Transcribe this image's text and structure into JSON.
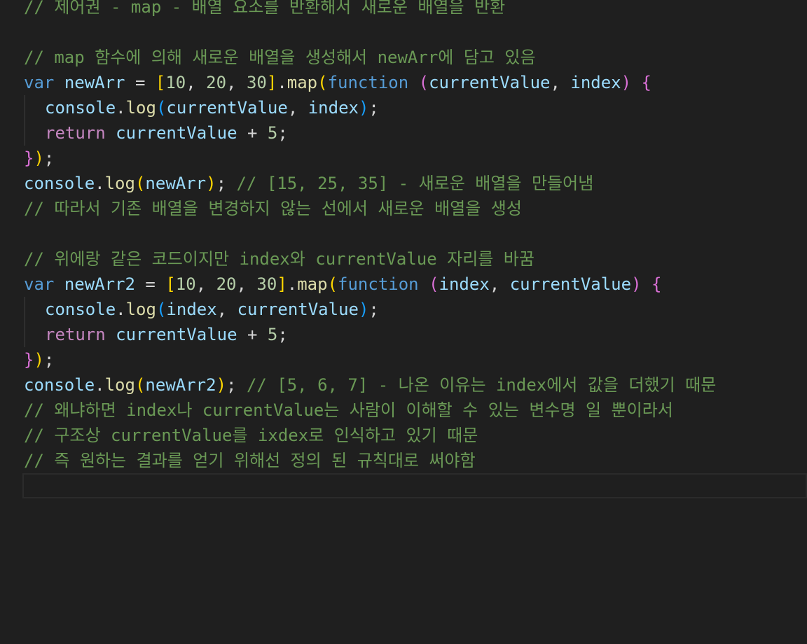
{
  "editor": {
    "lines": [
      {
        "segments": [
          {
            "t": "// 제어권 - map - 배열 요소를 반환해서 새로운 배열을 반환",
            "c": "comment"
          }
        ]
      },
      {
        "segments": []
      },
      {
        "segments": [
          {
            "t": "// map 함수에 의해 새로운 배열을 생성해서 newArr에 담고 있음",
            "c": "comment"
          }
        ]
      },
      {
        "segments": [
          {
            "t": "var",
            "c": "kw"
          },
          {
            "t": " ",
            "c": "op"
          },
          {
            "t": "newArr",
            "c": "var"
          },
          {
            "t": " = ",
            "c": "op"
          },
          {
            "t": "[",
            "c": "b1"
          },
          {
            "t": "10",
            "c": "num"
          },
          {
            "t": ", ",
            "c": "op"
          },
          {
            "t": "20",
            "c": "num"
          },
          {
            "t": ", ",
            "c": "op"
          },
          {
            "t": "30",
            "c": "num"
          },
          {
            "t": "]",
            "c": "b1"
          },
          {
            "t": ".",
            "c": "op"
          },
          {
            "t": "map",
            "c": "fn"
          },
          {
            "t": "(",
            "c": "b1"
          },
          {
            "t": "function",
            "c": "kw"
          },
          {
            "t": " ",
            "c": "op"
          },
          {
            "t": "(",
            "c": "b2"
          },
          {
            "t": "currentValue",
            "c": "var"
          },
          {
            "t": ", ",
            "c": "op"
          },
          {
            "t": "index",
            "c": "var"
          },
          {
            "t": ")",
            "c": "b2"
          },
          {
            "t": " ",
            "c": "op"
          },
          {
            "t": "{",
            "c": "b2"
          }
        ]
      },
      {
        "indent": true,
        "segments": [
          {
            "t": "console",
            "c": "var"
          },
          {
            "t": ".",
            "c": "op"
          },
          {
            "t": "log",
            "c": "fn"
          },
          {
            "t": "(",
            "c": "b3"
          },
          {
            "t": "currentValue",
            "c": "var"
          },
          {
            "t": ", ",
            "c": "op"
          },
          {
            "t": "index",
            "c": "var"
          },
          {
            "t": ")",
            "c": "b3"
          },
          {
            "t": ";",
            "c": "op"
          }
        ]
      },
      {
        "indent": true,
        "segments": [
          {
            "t": "return",
            "c": "ctrl"
          },
          {
            "t": " ",
            "c": "op"
          },
          {
            "t": "currentValue",
            "c": "var"
          },
          {
            "t": " + ",
            "c": "op"
          },
          {
            "t": "5",
            "c": "num"
          },
          {
            "t": ";",
            "c": "op"
          }
        ]
      },
      {
        "segments": [
          {
            "t": "}",
            "c": "b2"
          },
          {
            "t": ")",
            "c": "b1"
          },
          {
            "t": ";",
            "c": "op"
          }
        ]
      },
      {
        "segments": [
          {
            "t": "console",
            "c": "var"
          },
          {
            "t": ".",
            "c": "op"
          },
          {
            "t": "log",
            "c": "fn"
          },
          {
            "t": "(",
            "c": "b1"
          },
          {
            "t": "newArr",
            "c": "var"
          },
          {
            "t": ")",
            "c": "b1"
          },
          {
            "t": "; ",
            "c": "op"
          },
          {
            "t": "// [15, 25, 35] - 새로운 배열을 만들어냄",
            "c": "comment"
          }
        ]
      },
      {
        "segments": [
          {
            "t": "// 따라서 기존 배열을 변경하지 않는 선에서 새로운 배열을 생성",
            "c": "comment"
          }
        ]
      },
      {
        "segments": []
      },
      {
        "segments": [
          {
            "t": "// 위에랑 같은 코드이지만 index와 currentValue 자리를 바꿈",
            "c": "comment"
          }
        ]
      },
      {
        "segments": [
          {
            "t": "var",
            "c": "kw"
          },
          {
            "t": " ",
            "c": "op"
          },
          {
            "t": "newArr2",
            "c": "var"
          },
          {
            "t": " = ",
            "c": "op"
          },
          {
            "t": "[",
            "c": "b1"
          },
          {
            "t": "10",
            "c": "num"
          },
          {
            "t": ", ",
            "c": "op"
          },
          {
            "t": "20",
            "c": "num"
          },
          {
            "t": ", ",
            "c": "op"
          },
          {
            "t": "30",
            "c": "num"
          },
          {
            "t": "]",
            "c": "b1"
          },
          {
            "t": ".",
            "c": "op"
          },
          {
            "t": "map",
            "c": "fn"
          },
          {
            "t": "(",
            "c": "b1"
          },
          {
            "t": "function",
            "c": "kw"
          },
          {
            "t": " ",
            "c": "op"
          },
          {
            "t": "(",
            "c": "b2"
          },
          {
            "t": "index",
            "c": "var"
          },
          {
            "t": ", ",
            "c": "op"
          },
          {
            "t": "currentValue",
            "c": "var"
          },
          {
            "t": ")",
            "c": "b2"
          },
          {
            "t": " ",
            "c": "op"
          },
          {
            "t": "{",
            "c": "b2"
          }
        ]
      },
      {
        "indent": true,
        "segments": [
          {
            "t": "console",
            "c": "var"
          },
          {
            "t": ".",
            "c": "op"
          },
          {
            "t": "log",
            "c": "fn"
          },
          {
            "t": "(",
            "c": "b3"
          },
          {
            "t": "index",
            "c": "var"
          },
          {
            "t": ", ",
            "c": "op"
          },
          {
            "t": "currentValue",
            "c": "var"
          },
          {
            "t": ")",
            "c": "b3"
          },
          {
            "t": ";",
            "c": "op"
          }
        ]
      },
      {
        "indent": true,
        "segments": [
          {
            "t": "return",
            "c": "ctrl"
          },
          {
            "t": " ",
            "c": "op"
          },
          {
            "t": "currentValue",
            "c": "var"
          },
          {
            "t": " + ",
            "c": "op"
          },
          {
            "t": "5",
            "c": "num"
          },
          {
            "t": ";",
            "c": "op"
          }
        ]
      },
      {
        "segments": [
          {
            "t": "}",
            "c": "b2"
          },
          {
            "t": ")",
            "c": "b1"
          },
          {
            "t": ";",
            "c": "op"
          }
        ]
      },
      {
        "segments": [
          {
            "t": "console",
            "c": "var"
          },
          {
            "t": ".",
            "c": "op"
          },
          {
            "t": "log",
            "c": "fn"
          },
          {
            "t": "(",
            "c": "b1"
          },
          {
            "t": "newArr2",
            "c": "var"
          },
          {
            "t": ")",
            "c": "b1"
          },
          {
            "t": "; ",
            "c": "op"
          },
          {
            "t": "// [5, 6, 7] - 나온 이유는 index에서 값을 더했기 때문",
            "c": "comment"
          }
        ]
      },
      {
        "segments": [
          {
            "t": "// 왜냐하면 index나 currentValue는 사람이 이해할 수 있는 변수명 일 뿐이라서",
            "c": "comment"
          }
        ]
      },
      {
        "segments": [
          {
            "t": "// 구조상 currentValue를 ixdex로 인식하고 있기 때문",
            "c": "comment"
          }
        ]
      },
      {
        "segments": [
          {
            "t": "// 즉 원하는 결과를 얻기 위해선 정의 된 규칙대로 써야함",
            "c": "comment"
          }
        ]
      },
      {
        "current": true,
        "segments": []
      }
    ]
  },
  "colors": {
    "background": "#1f1f1f",
    "comment": "#6a9955",
    "keyword": "#569cd6",
    "control": "#c586c0",
    "variable": "#9cdcfe",
    "function": "#dcdcaa",
    "number": "#b5cea8"
  }
}
